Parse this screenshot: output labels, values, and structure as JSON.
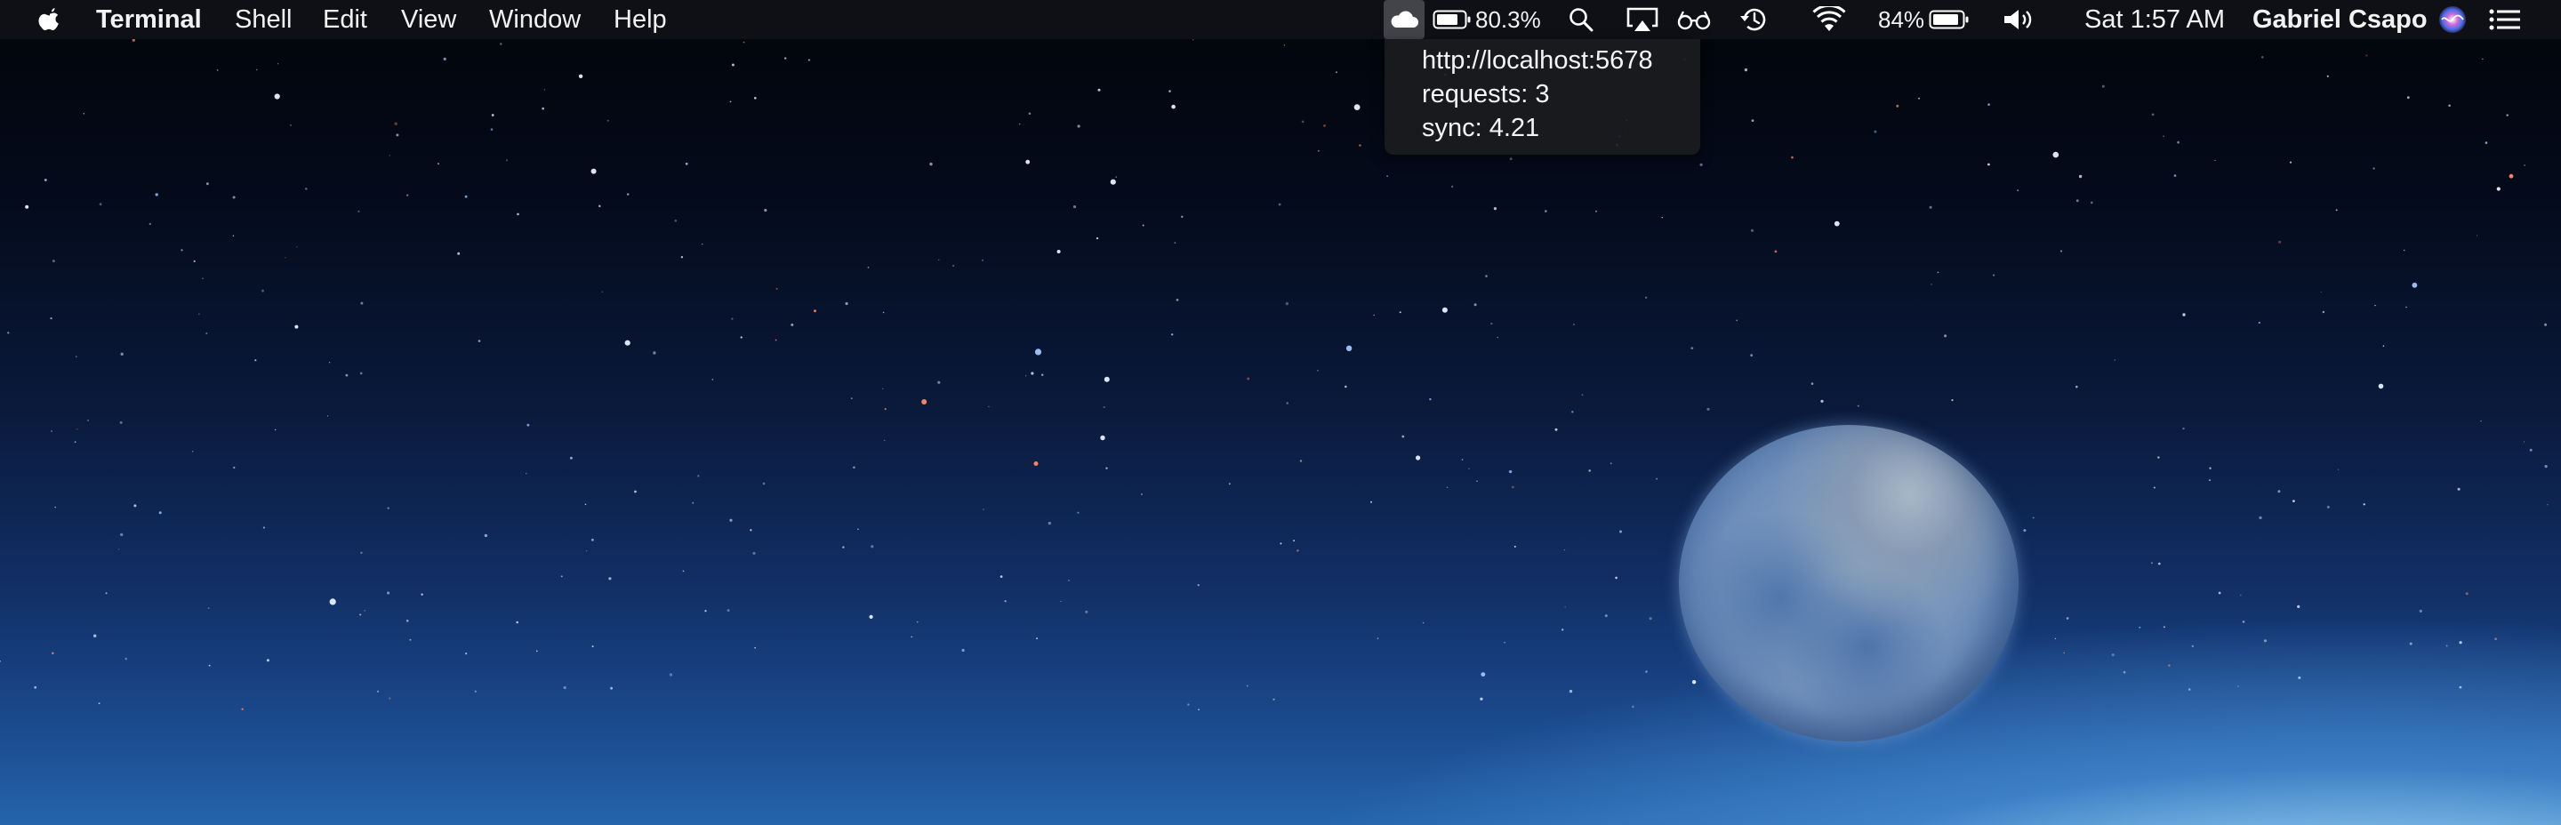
{
  "menubar": {
    "app_name": "Terminal",
    "menus": [
      "Shell",
      "Edit",
      "View",
      "Window",
      "Help"
    ],
    "status": {
      "battery_percent_1": "80.3%",
      "battery_percent_2": "84%",
      "clock": "Sat 1:57 AM",
      "user": "Gabriel Csapo"
    },
    "icons": [
      "apple-logo-icon",
      "cloud-icon",
      "battery-icon",
      "search-icon",
      "airplay-icon",
      "glasses-icon",
      "time-machine-icon",
      "wifi-icon",
      "battery-icon",
      "volume-icon",
      "siri-icon",
      "notification-center-icon"
    ]
  },
  "popup": {
    "url": "http://localhost:5678",
    "requests": "requests: 3",
    "sync": "sync: 4.21"
  }
}
